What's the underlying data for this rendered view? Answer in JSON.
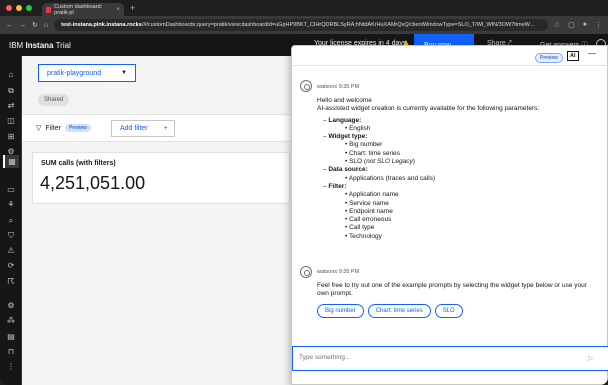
{
  "browser": {
    "tab_title": "Custom dashboard: pratik-pl",
    "url_host": "test-instana.pink.instana.rocks",
    "url_path": "/#/customDashboards;query=pratik/view;dashboardId=uGpHP9BKT_CIHrQDRBLSyRA;hNtdAKrHuXAMrQvQ/clientWindowType=SLO_T/WI_WIN/3OW?timeW..."
  },
  "header": {
    "brand_prefix": "IBM",
    "brand_name": "Instana",
    "brand_suffix": "Trial",
    "license": "Your license expires in 4 days",
    "buy_now": "Buy now",
    "share": "Share",
    "get_answers": "Get answers"
  },
  "dashboard": {
    "selector": "pratik-playground",
    "shared": "Shared",
    "filter_label": "Filter",
    "filter_preview": "Preview",
    "add_filter": "Add filter",
    "add_filter_icon": "+",
    "widget_title": "SUM calls (with filters)",
    "widget_value": "4,251,051.00"
  },
  "chat": {
    "preview": "Preview",
    "ai": "AI",
    "sender1": "watsonx 9:35 PM",
    "greeting": "Hello and welcome",
    "intro": "AI-assisted widget creation is currently available for the following parameters:",
    "language_h": "Language:",
    "language_1": "English",
    "widget_h": "Widget type:",
    "widget_1": "Big number",
    "widget_2": "Chart: time series",
    "widget_3a": "SLO (",
    "widget_3b": "not SLO Legacy",
    "widget_3c": ")",
    "source_h": "Data source:",
    "source_1": "Applications (traces and calls)",
    "filter_h": "Filter:",
    "filter_1": "Application name",
    "filter_2": "Service name",
    "filter_3": "Endpoint name",
    "filter_4": "Call erroneous",
    "filter_5": "Call type",
    "filter_6": "Technology",
    "sender2": "watsonx 9:35 PM",
    "prompt_line1": "Feel free to try out one of the example prompts by selecting the widget type below or use your",
    "prompt_line2": "own prompt.",
    "pill1": "Big number",
    "pill2": "Chart: time series",
    "pill3": "SLO",
    "input_placeholder": "Type something..."
  }
}
